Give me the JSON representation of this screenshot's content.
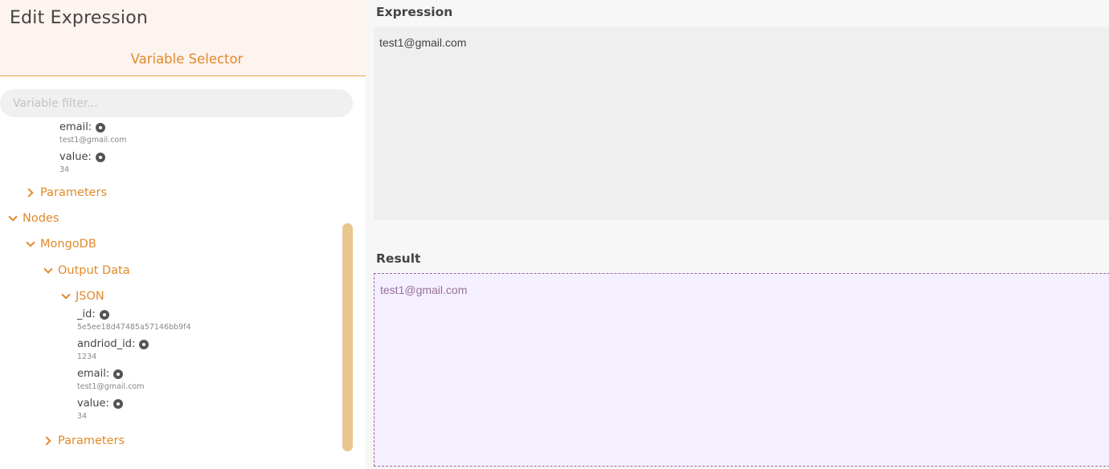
{
  "header": {
    "title": "Edit Expression",
    "selector_title": "Variable Selector"
  },
  "filter": {
    "placeholder": "Variable filter...",
    "value": ""
  },
  "tree": {
    "top_vars": [
      {
        "name": "email:",
        "value": "test1@gmail.com"
      },
      {
        "name": "value:",
        "value": "34"
      }
    ],
    "parameters_1": "Parameters",
    "nodes": "Nodes",
    "mongodb": "MongoDB",
    "output_data": "Output Data",
    "json": "JSON",
    "json_vars": [
      {
        "name": "_id:",
        "value": "5e5ee18d47485a57146bb9f4"
      },
      {
        "name": "andriod_id:",
        "value": "1234"
      },
      {
        "name": "email:",
        "value": "test1@gmail.com"
      },
      {
        "name": "value:",
        "value": "34"
      }
    ],
    "parameters_2": "Parameters"
  },
  "expression": {
    "label": "Expression",
    "value": "test1@gmail.com"
  },
  "result": {
    "label": "Result",
    "value": "test1@gmail.com"
  },
  "colors": {
    "accent": "#e08a2a",
    "header_bg": "#fdf3ef",
    "result_border": "#a0659a"
  }
}
